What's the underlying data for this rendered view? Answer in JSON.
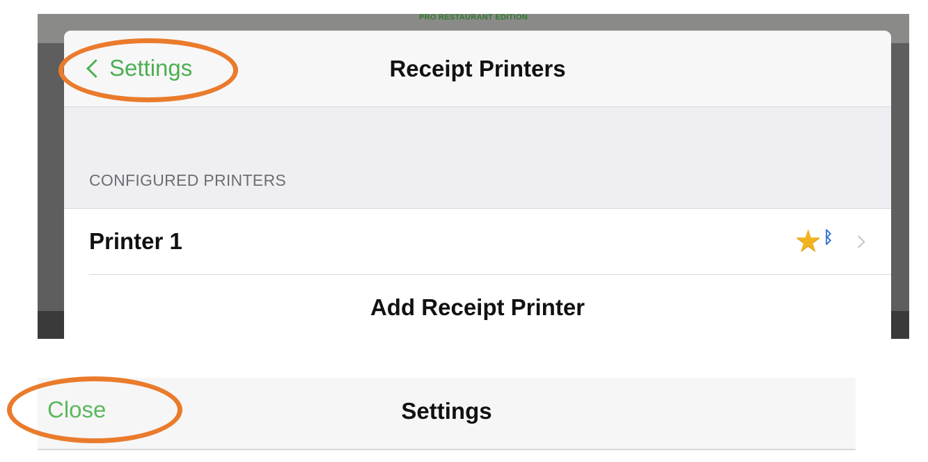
{
  "top_screen": {
    "edition_label": "PRO RESTAURANT EDITION",
    "nav_bar": {
      "back_label": "Settings",
      "back_icon": "chevron-left-icon",
      "title": "Receipt Printers"
    },
    "section_header": "CONFIGURED PRINTERS",
    "printers": [
      {
        "name": "Printer 1",
        "icons": [
          "star-icon",
          "bluetooth-icon",
          "chevron-right-icon"
        ]
      }
    ],
    "add_printer_label": "Add Receipt Printer"
  },
  "bottom_screen": {
    "close_label": "Close",
    "title": "Settings"
  },
  "colors": {
    "accent_green": "#4caf50",
    "annotation_orange": "#ea7b2c",
    "star_gold": "#f2b31f",
    "bluetooth_blue": "#2f6fd6"
  }
}
